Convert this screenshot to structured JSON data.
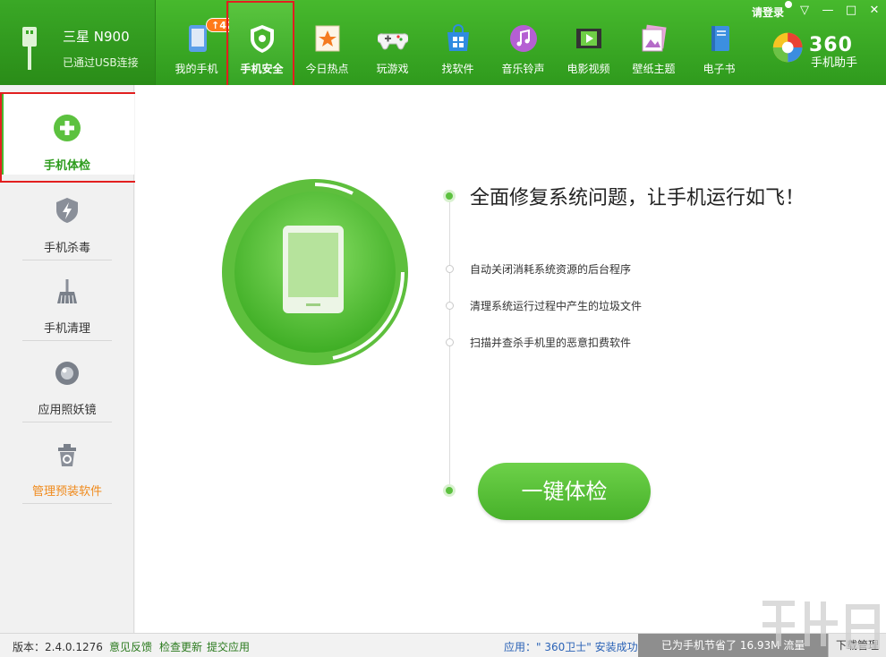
{
  "device": {
    "name": "三星 N900",
    "status": "已通过USB连接"
  },
  "nav": {
    "items": [
      {
        "label": "我的手机",
        "icon": "my-phone-icon",
        "badge": "↑42"
      },
      {
        "label": "手机安全",
        "icon": "shield-icon"
      },
      {
        "label": "今日热点",
        "icon": "hot-news-icon"
      },
      {
        "label": "玩游戏",
        "icon": "gamepad-icon"
      },
      {
        "label": "找软件",
        "icon": "app-store-icon"
      },
      {
        "label": "音乐铃声",
        "icon": "music-icon"
      },
      {
        "label": "电影视频",
        "icon": "film-icon"
      },
      {
        "label": "壁纸主题",
        "icon": "wallpaper-icon"
      },
      {
        "label": "电子书",
        "icon": "ebook-icon"
      }
    ],
    "active_index": 1
  },
  "window": {
    "login": "请登录"
  },
  "logo": {
    "text": "360",
    "sub": "手机助手"
  },
  "sidebar": {
    "items": [
      {
        "label": "手机体检",
        "icon": "plus-icon"
      },
      {
        "label": "手机杀毒",
        "icon": "shield-bolt-icon"
      },
      {
        "label": "手机清理",
        "icon": "broom-icon"
      },
      {
        "label": "应用照妖镜",
        "icon": "lens-icon"
      },
      {
        "label": "管理预装软件",
        "icon": "trash-box-icon"
      }
    ]
  },
  "main": {
    "headline": "全面修复系统问题，让手机运行如飞！",
    "bullets": [
      "自动关闭消耗系统资源的后台程序",
      "清理系统运行过程中产生的垃圾文件",
      "扫描并查杀手机里的恶意扣费软件"
    ],
    "button": "一键体检"
  },
  "statusbar": {
    "version": "版本：2.4.0.1276",
    "feedback": "意见反馈",
    "check_update": "检查更新",
    "submit_app": "提交应用",
    "app_msg": "应用：\" 360卫士\" 安装成功",
    "saved": "已为手机节省了 16.93M 流量",
    "download_mgr": "下载管理"
  },
  "colors": {
    "brand_green": "#3aa826",
    "accent_orange": "#f08a1c",
    "highlight_red": "#e21f1f"
  }
}
